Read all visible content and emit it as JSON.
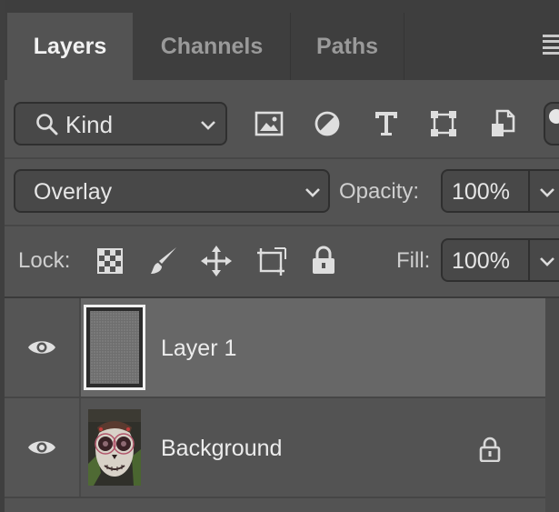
{
  "tabs": [
    {
      "label": "Layers",
      "active": true
    },
    {
      "label": "Channels",
      "active": false
    },
    {
      "label": "Paths",
      "active": false
    }
  ],
  "filter": {
    "kind_label": "Kind",
    "icons": [
      "image-filter-icon",
      "adjustment-filter-icon",
      "type-filter-icon",
      "shape-filter-icon",
      "smart-object-filter-icon",
      "filter-toggle-icon"
    ]
  },
  "blend": {
    "mode": "Overlay",
    "opacity_label": "Opacity:",
    "opacity_value": "100%"
  },
  "lock": {
    "label": "Lock:",
    "icons": [
      "lock-transparent-pixels-icon",
      "lock-image-pixels-icon",
      "lock-position-icon",
      "lock-artboard-icon",
      "lock-all-icon"
    ],
    "fill_label": "Fill:",
    "fill_value": "100%"
  },
  "layers": [
    {
      "name": "Layer 1",
      "visible": true,
      "selected": true,
      "locked": false
    },
    {
      "name": "Background",
      "visible": true,
      "selected": false,
      "locked": true
    }
  ],
  "colors": {
    "panel_bg": "#535353",
    "tabbar_bg": "#3e3e3e",
    "selected_row": "#676767",
    "field_bg": "#484848"
  }
}
